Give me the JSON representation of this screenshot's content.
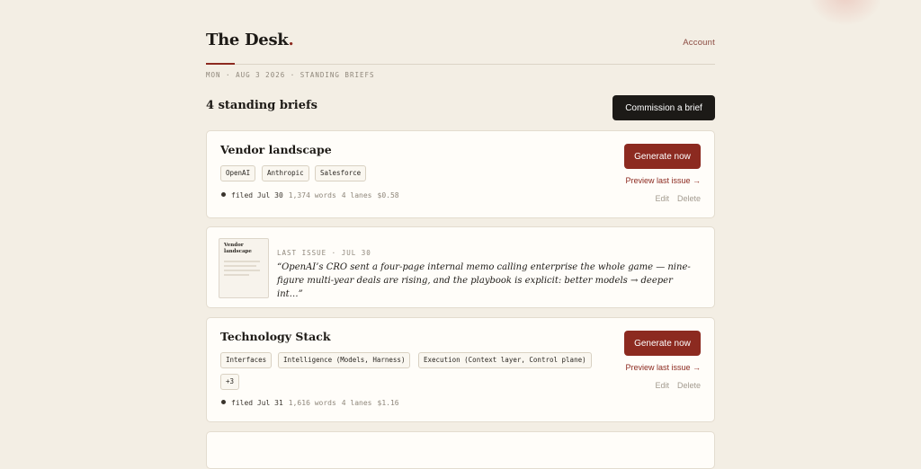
{
  "header": {
    "brand": "The Desk",
    "brand_dot": ".",
    "account_label": "Account",
    "dateline": "MON · AUG 3 2026 · STANDING BRIEFS"
  },
  "section": {
    "title": "4 standing briefs",
    "commission_label": "Commission a brief"
  },
  "briefs": [
    {
      "title": "Vendor landscape",
      "tags": [
        "OpenAI",
        "Anthropic",
        "Salesforce"
      ],
      "filed": "filed Jul 30",
      "words": "1,374 words",
      "lanes": "4 lanes",
      "cost": "$0.58",
      "generate_label": "Generate now",
      "preview_label": "Preview last issue →",
      "edit_label": "Edit",
      "delete_label": "Delete"
    },
    {
      "title": "Technology Stack",
      "tags": [
        "Interfaces",
        "Intelligence (Models, Harness)",
        "Execution (Context layer, Control plane)",
        "+3"
      ],
      "filed": "filed Jul 31",
      "words": "1,616 words",
      "lanes": "4 lanes",
      "cost": "$1.16",
      "generate_label": "Generate now",
      "preview_label": "Preview last issue →",
      "edit_label": "Edit",
      "delete_label": "Delete"
    }
  ],
  "last_issue": {
    "thumb_title": "Vendor landscape",
    "label": "LAST ISSUE · JUL 30",
    "quote": "“OpenAI’s CRO sent a four-page internal memo calling enterprise the whole game — nine-figure multi-year deals are rising, and the playbook is explicit: better models → deeper int…”"
  },
  "colors": {
    "background": "#f3eee4",
    "accent": "#8c2a20",
    "dark_button": "#1c1a17",
    "card": "#fffdf9"
  }
}
